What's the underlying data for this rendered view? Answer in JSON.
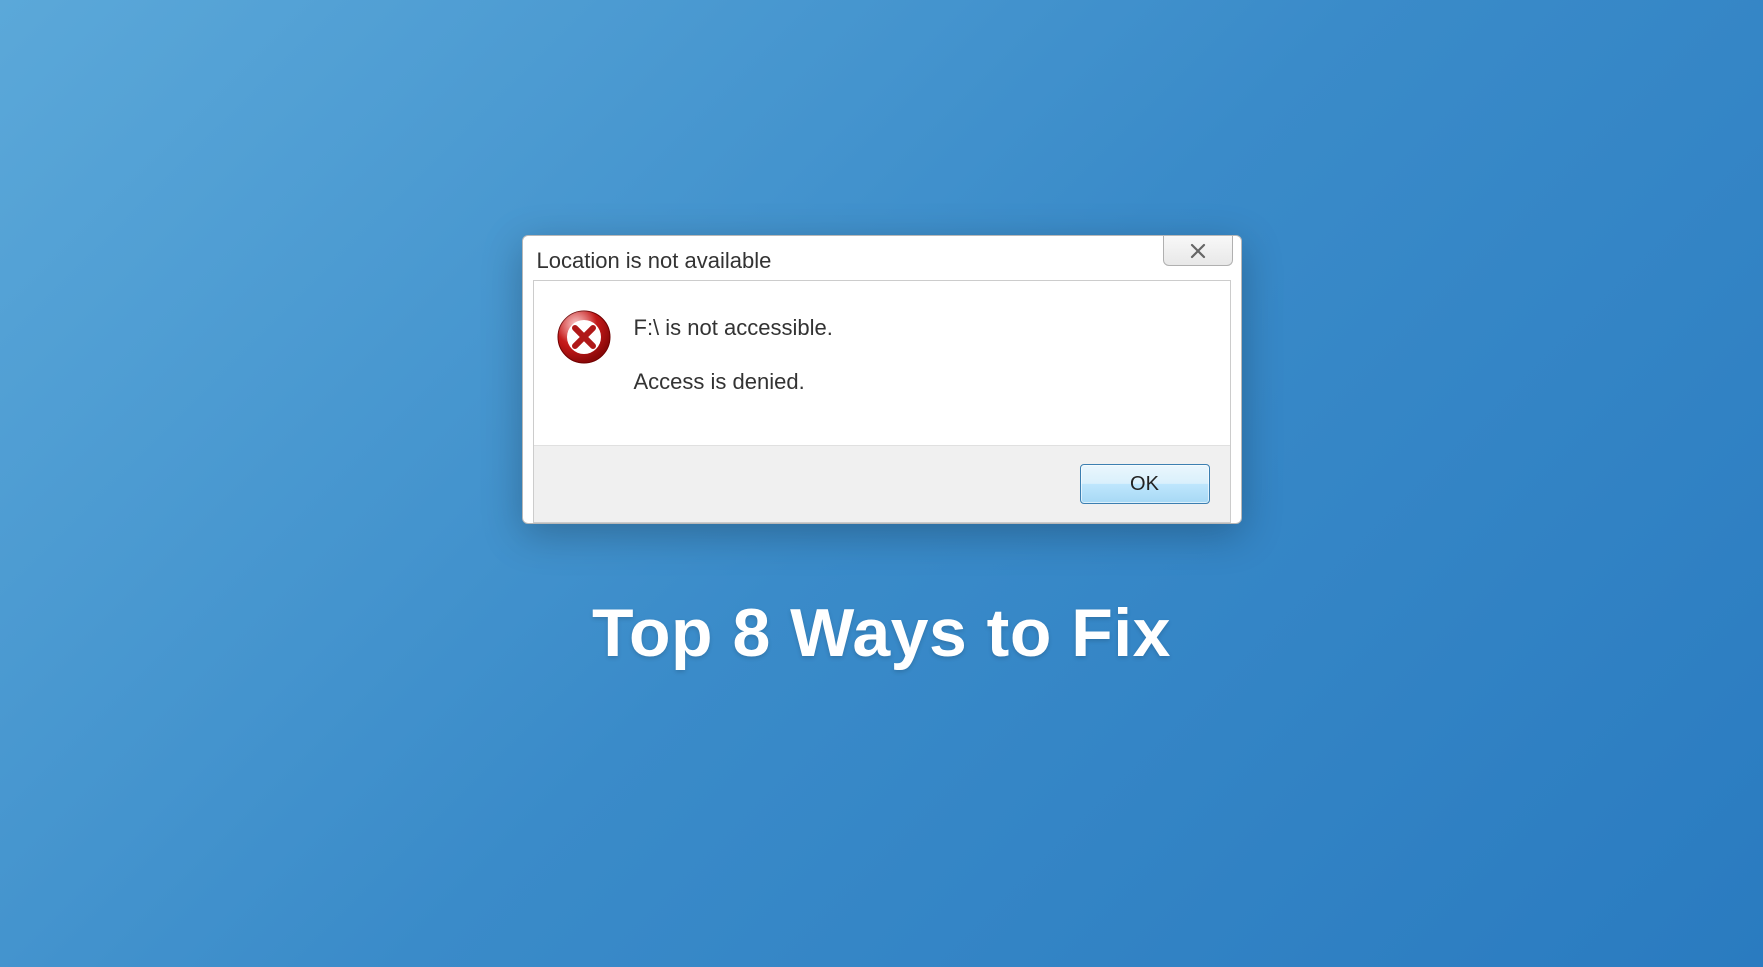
{
  "dialog": {
    "title": "Location is not available",
    "message_line1": "F:\\ is not accessible.",
    "message_line2": "Access is denied.",
    "ok_label": "OK"
  },
  "caption": "Top 8 Ways to Fix",
  "colors": {
    "background_start": "#5ba8d9",
    "background_end": "#2a7bc0",
    "error_icon": "#b01818",
    "ok_button_border": "#3c7fb1"
  }
}
